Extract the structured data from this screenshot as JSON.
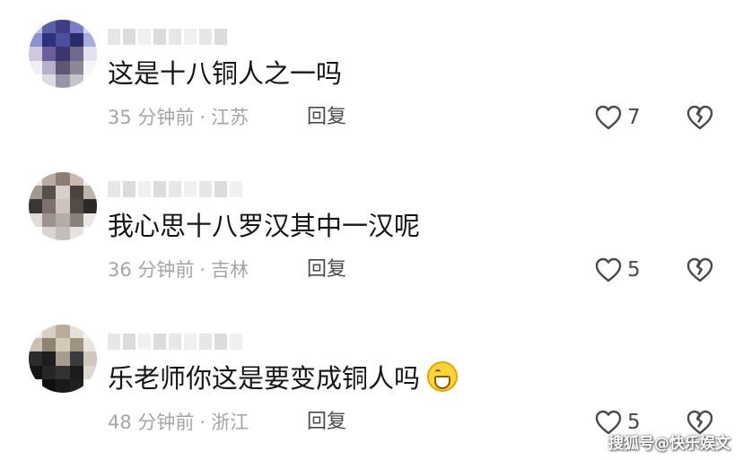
{
  "comments": [
    {
      "text": "这是十八铜人之一吗",
      "time": "35 分钟前",
      "location": "江苏",
      "reply_label": "回复",
      "likes": "7",
      "avatar_colors": [
        "#b9bfe0",
        "#5b5fa8",
        "#3e3f86",
        "#7a7fc3",
        "#d2d5ee",
        "#8c91cf",
        "#2f317a",
        "#4b4fa0",
        "#2b2d6b",
        "#a9add9",
        "#cfc8de",
        "#6a5f9a",
        "#3b3670",
        "#6f6a8f",
        "#e4e1ea",
        "#f0eef6",
        "#b7b0c8",
        "#5e5773",
        "#8e8796",
        "#f6f5f8",
        "#ffffff",
        "#ded9e6",
        "#9a95a6",
        "#c7c3cd",
        "#ffffff"
      ]
    },
    {
      "text": "我心思十八罗汉其中一汉呢",
      "time": "36 分钟前",
      "location": "吉林",
      "reply_label": "回复",
      "likes": "5",
      "avatar_colors": [
        "#e8e3e0",
        "#b9aca4",
        "#8d7c72",
        "#c6bab3",
        "#f1eeec",
        "#a29893",
        "#5a504b",
        "#d8cfc9",
        "#4a4240",
        "#bdb3ad",
        "#3a3634",
        "#7d716b",
        "#cdc3bd",
        "#544b47",
        "#2b2827",
        "#e0dbd8",
        "#9c938e",
        "#b2aba6",
        "#8a817c",
        "#ebe7e5",
        "#ffffff",
        "#d9d4d1",
        "#c4beba",
        "#e7e3e1",
        "#ffffff"
      ]
    },
    {
      "text": "乐老师你这是要变成铜人吗",
      "time": "48 分钟前",
      "location": "浙江",
      "reply_label": "回复",
      "likes": "5",
      "avatar_colors": [
        "#f1ede6",
        "#d8d0c4",
        "#b7ab9a",
        "#e6e0d6",
        "#f6f4f0",
        "#c9c0b3",
        "#8f8474",
        "#d4c9b8",
        "#9f9384",
        "#e9e4dc",
        "#2c2c2c",
        "#1d1d1d",
        "#a69d90",
        "#3a3a3a",
        "#cfc8bd",
        "#141414",
        "#262626",
        "#323232",
        "#1b1b1b",
        "#dcd7cf",
        "#ffffff",
        "#0f0f0f",
        "#1a1a1a",
        "#202020",
        "#ffffff"
      ]
    }
  ],
  "watermark": "搜狐号@快乐娱文",
  "colors": {
    "text": "#151515",
    "meta": "#a5a5a5",
    "action": "#4a4a4a",
    "background": "#ffffff"
  },
  "icons": {
    "like": "heart-outline-icon",
    "dislike": "broken-heart-icon",
    "emoji": "grinning-face-icon"
  }
}
